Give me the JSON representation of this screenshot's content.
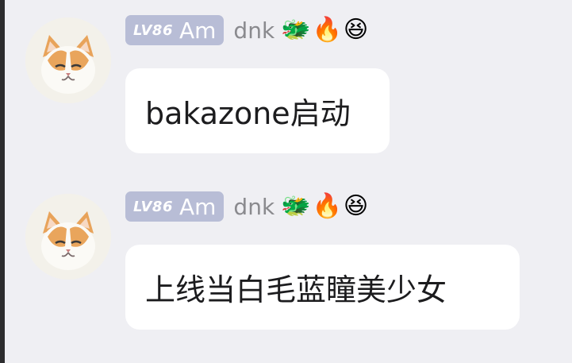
{
  "messages": [
    {
      "avatar_icon": "cat-avatar-icon",
      "level_tag": "LV86",
      "title": "Am",
      "username": "dnk",
      "badges": [
        {
          "name": "dragon-badge-icon",
          "glyph": "🐲"
        },
        {
          "name": "fire-badge-icon",
          "glyph": "🔥"
        },
        {
          "name": "smile-flower-badge-icon",
          "glyph": "😆"
        }
      ],
      "text": "bakazone启动"
    },
    {
      "avatar_icon": "cat-avatar-icon",
      "level_tag": "LV86",
      "title": "Am",
      "username": "dnk",
      "badges": [
        {
          "name": "dragon-badge-icon",
          "glyph": "🐲"
        },
        {
          "name": "fire-badge-icon",
          "glyph": "🔥"
        },
        {
          "name": "smile-flower-badge-icon",
          "glyph": "😆"
        }
      ],
      "text": "上线当白毛蓝瞳美少女"
    }
  ],
  "colors": {
    "background": "#efeff3",
    "badge_bg": "#b8bdd6",
    "username": "#8a8a8e",
    "bubble": "#ffffff"
  }
}
